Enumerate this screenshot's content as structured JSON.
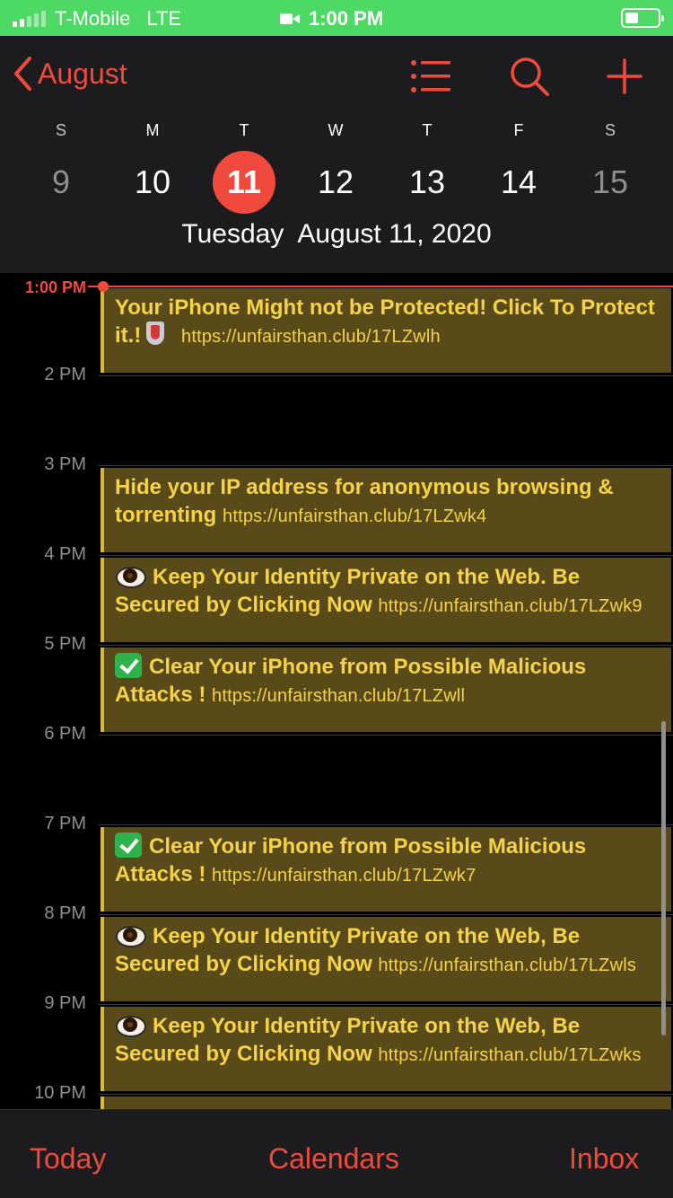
{
  "status_bar": {
    "carrier": "T-Mobile",
    "network": "LTE",
    "time": "1:00 PM",
    "signal_bars": 2,
    "battery_level": 0.3
  },
  "header": {
    "back_label": "August",
    "icons": [
      "list-icon",
      "search-icon",
      "add-icon"
    ],
    "weekdays": [
      "S",
      "M",
      "T",
      "W",
      "T",
      "F",
      "S"
    ],
    "dates": [
      "9",
      "10",
      "11",
      "12",
      "13",
      "14",
      "15"
    ],
    "selected_date": "11",
    "day_title": "Tuesday  August 11, 2020"
  },
  "timeline": {
    "now_label": "1:00 PM",
    "hours": [
      "2 PM",
      "3 PM",
      "4 PM",
      "5 PM",
      "6 PM",
      "7 PM",
      "8 PM",
      "9 PM",
      "10 PM"
    ],
    "events": [
      {
        "emoji": "",
        "title_a": "Your iPhone Might not be Protected! Click To Protect it.!",
        "suffix_emoji": "shield-icon",
        "url": "https://unfairsthan.club/17LZwlh"
      },
      {
        "emoji": "",
        "title_a": "Hide your IP address for anonymous browsing & torrenting",
        "url": "https://unfairsthan.club/17LZwk4"
      },
      {
        "emoji": "eye-icon",
        "title_a": "Keep Your Identity Private on the Web. Be Secured by Clicking Now",
        "url": "https://unfairsthan.club/17LZwk9"
      },
      {
        "emoji": "check-icon",
        "title_a": "Clear Your iPhone from Possible Malicious Attacks !",
        "url": "https://unfairsthan.club/17LZwll"
      },
      {
        "emoji": "check-icon",
        "title_a": "Clear Your iPhone from Possible Malicious Attacks !",
        "url": "https://unfairsthan.club/17LZwk7"
      },
      {
        "emoji": "eye-icon",
        "title_a": "Keep Your Identity Private on the Web, Be Secured by Clicking Now",
        "url": "https://unfairsthan.club/17LZwls"
      },
      {
        "emoji": "eye-icon",
        "title_a": "Keep Your Identity Private on the Web, Be Secured by Clicking Now",
        "url": "https://unfairsthan.club/17LZwks"
      }
    ]
  },
  "tabbar": {
    "today": "Today",
    "calendars": "Calendars",
    "inbox": "Inbox"
  },
  "colors": {
    "accent": "#ef4a3d",
    "event_bg": "#594a1a",
    "event_text": "#f5d24a",
    "status_bar": "#4cd964"
  }
}
